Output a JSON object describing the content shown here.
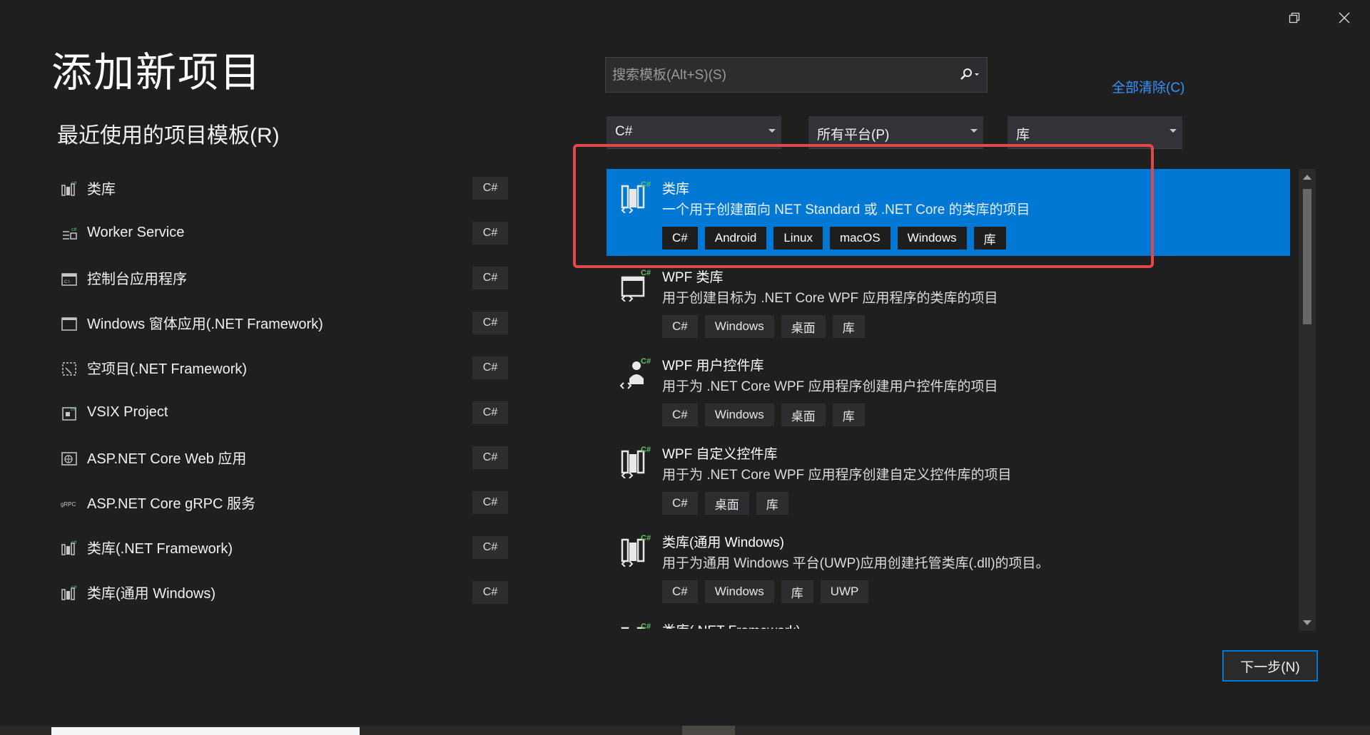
{
  "window": {
    "restore_icon": "restore-icon",
    "close_icon": "close-icon"
  },
  "page": {
    "title": "添加新项目",
    "recent_title": "最近使用的项目模板(R)"
  },
  "recent_templates": [
    {
      "label": "类库",
      "lang": "C#",
      "icon": "class-library-icon"
    },
    {
      "label": "Worker Service",
      "lang": "C#",
      "icon": "worker-service-icon"
    },
    {
      "label": "控制台应用程序",
      "lang": "C#",
      "icon": "console-app-icon"
    },
    {
      "label": "Windows 窗体应用(.NET Framework)",
      "lang": "C#",
      "icon": "windows-forms-icon"
    },
    {
      "label": "空项目(.NET Framework)",
      "lang": "C#",
      "icon": "empty-project-icon"
    },
    {
      "label": "VSIX Project",
      "lang": "C#",
      "icon": "vsix-project-icon"
    },
    {
      "label": "ASP.NET Core Web 应用",
      "lang": "C#",
      "icon": "web-app-icon"
    },
    {
      "label": "ASP.NET Core gRPC 服务",
      "lang": "C#",
      "icon": "grpc-icon"
    },
    {
      "label": "类库(.NET Framework)",
      "lang": "C#",
      "icon": "class-library-icon"
    },
    {
      "label": "类库(通用 Windows)",
      "lang": "C#",
      "icon": "class-library-icon"
    }
  ],
  "search": {
    "placeholder": "搜索模板(Alt+S)(S)",
    "icon": "search-icon"
  },
  "clear_all": "全部清除(C)",
  "filters": {
    "language": "C#",
    "platform": "所有平台(P)",
    "project_type": "库"
  },
  "templates": [
    {
      "name": "类库",
      "description": "一个用于创建面向 NET Standard 或 .NET Core 的类库的项目",
      "tags": [
        "C#",
        "Android",
        "Linux",
        "macOS",
        "Windows",
        "库"
      ],
      "selected": true
    },
    {
      "name": "WPF 类库",
      "description": "用于创建目标为 .NET Core WPF 应用程序的类库的项目",
      "tags": [
        "C#",
        "Windows",
        "桌面",
        "库"
      ],
      "selected": false
    },
    {
      "name": "WPF 用户控件库",
      "description": "用于为 .NET Core WPF 应用程序创建用户控件库的项目",
      "tags": [
        "C#",
        "Windows",
        "桌面",
        "库"
      ],
      "selected": false
    },
    {
      "name": "WPF 自定义控件库",
      "description": "用于为 .NET Core WPF 应用程序创建自定义控件库的项目",
      "tags": [
        "C#",
        "桌面",
        "库"
      ],
      "selected": false
    },
    {
      "name": "类库(通用 Windows)",
      "description": "用于为通用 Windows 平台(UWP)应用创建托管类库(.dll)的项目。",
      "tags": [
        "C#",
        "Windows",
        "库",
        "UWP"
      ],
      "selected": false
    },
    {
      "name": "类库(.NET Framework)",
      "description": "",
      "tags": [],
      "selected": false
    }
  ],
  "next_button": "下一步(N)",
  "accent_colors": {
    "selection": "#0078d4",
    "link": "#3794ff",
    "highlight_box": "#e0484b"
  }
}
